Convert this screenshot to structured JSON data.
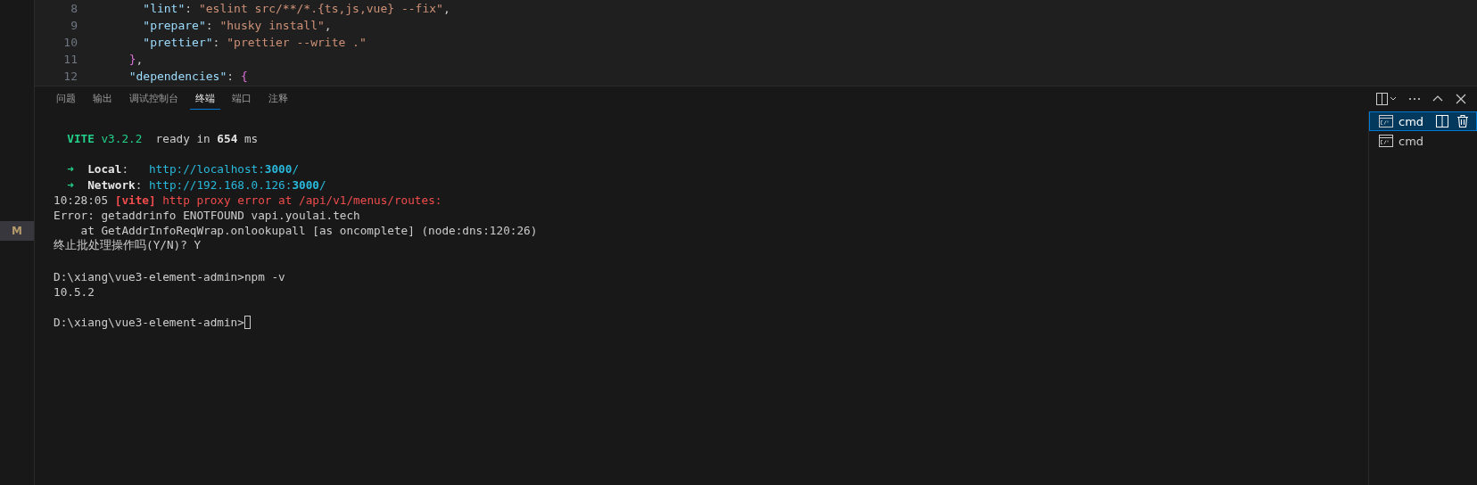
{
  "editor": {
    "lines": [
      {
        "number": "8",
        "segments": [
          {
            "kind": "key",
            "text": "    \"lint\""
          },
          {
            "kind": "punct",
            "text": ": "
          },
          {
            "kind": "string",
            "text": "\"eslint src/**/*.{ts,js,vue} --fix\""
          },
          {
            "kind": "punct",
            "text": ","
          }
        ]
      },
      {
        "number": "9",
        "segments": [
          {
            "kind": "key",
            "text": "    \"prepare\""
          },
          {
            "kind": "punct",
            "text": ": "
          },
          {
            "kind": "string",
            "text": "\"husky install\""
          },
          {
            "kind": "punct",
            "text": ","
          }
        ]
      },
      {
        "number": "10",
        "segments": [
          {
            "kind": "key",
            "text": "    \"prettier\""
          },
          {
            "kind": "punct",
            "text": ": "
          },
          {
            "kind": "string",
            "text": "\"prettier --write .\""
          }
        ]
      },
      {
        "number": "11",
        "segments": [
          {
            "kind": "brace",
            "text": "  }"
          },
          {
            "kind": "punct",
            "text": ","
          }
        ]
      },
      {
        "number": "12",
        "segments": [
          {
            "kind": "key",
            "text": "  \"dependencies\""
          },
          {
            "kind": "punct",
            "text": ": "
          },
          {
            "kind": "brace",
            "text": "{"
          }
        ]
      }
    ]
  },
  "activity_badge": "M",
  "panel": {
    "tabs": [
      {
        "label": "问题",
        "selected": false
      },
      {
        "label": "输出",
        "selected": false
      },
      {
        "label": "调试控制台",
        "selected": false
      },
      {
        "label": "终端",
        "selected": true
      },
      {
        "label": "端口",
        "selected": false
      },
      {
        "label": "注释",
        "selected": false
      }
    ],
    "terminal_blocks": [
      {
        "lines": [
          {
            "segments": [
              {
                "kind": "greenbold",
                "text": "  VITE"
              },
              {
                "kind": "green",
                "text": " v3.2.2"
              },
              {
                "kind": "plain",
                "text": "  ready in "
              },
              {
                "kind": "bold",
                "text": "654"
              },
              {
                "kind": "plain",
                "text": " ms"
              }
            ]
          }
        ]
      },
      {
        "lines": [
          {
            "segments": [
              {
                "kind": "green",
                "text": "  ➜  "
              },
              {
                "kind": "bold",
                "text": "Local"
              },
              {
                "kind": "plain",
                "text": ":   "
              },
              {
                "kind": "cyan",
                "text": "http://localhost:"
              },
              {
                "kind": "cyanbold",
                "text": "3000"
              },
              {
                "kind": "cyan",
                "text": "/"
              }
            ]
          },
          {
            "segments": [
              {
                "kind": "green",
                "text": "  ➜  "
              },
              {
                "kind": "bold",
                "text": "Network"
              },
              {
                "kind": "plain",
                "text": ": "
              },
              {
                "kind": "cyan",
                "text": "http://192.168.0.126:"
              },
              {
                "kind": "cyanbold",
                "text": "3000"
              },
              {
                "kind": "cyan",
                "text": "/"
              }
            ]
          },
          {
            "segments": [
              {
                "kind": "plain",
                "text": "10:28:05 "
              },
              {
                "kind": "redbold",
                "text": "[vite]"
              },
              {
                "kind": "red",
                "text": " http proxy error at /api/v1/menus/routes:"
              }
            ]
          },
          {
            "segments": [
              {
                "kind": "plain",
                "text": "Error: getaddrinfo ENOTFOUND vapi.youlai.tech"
              }
            ]
          },
          {
            "segments": [
              {
                "kind": "plain",
                "text": "    at GetAddrInfoReqWrap.onlookupall [as oncomplete] (node:dns:120:26)"
              }
            ]
          },
          {
            "segments": [
              {
                "kind": "plain",
                "text": "终止批处理操作吗(Y/N)? Y"
              }
            ]
          }
        ]
      },
      {
        "lines": [
          {
            "segments": [
              {
                "kind": "plain",
                "text": "D:\\xiang\\vue3-element-admin>npm -v"
              }
            ]
          },
          {
            "segments": [
              {
                "kind": "plain",
                "text": "10.5.2"
              }
            ]
          }
        ]
      },
      {
        "lines": [
          {
            "segments": [
              {
                "kind": "plain",
                "text": "D:\\xiang\\vue3-element-admin>"
              }
            ],
            "cursor": true
          }
        ]
      }
    ],
    "terminals": [
      {
        "label": "cmd",
        "selected": true
      },
      {
        "label": "cmd",
        "selected": false
      }
    ]
  }
}
